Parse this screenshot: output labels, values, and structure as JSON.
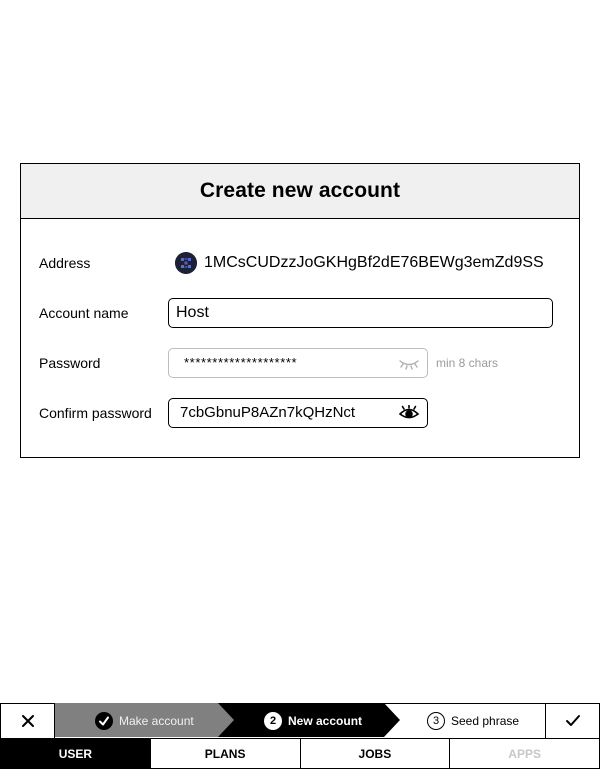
{
  "dialog": {
    "title": "Create new account",
    "address": {
      "label": "Address",
      "value": "1MCsCUDzzJoGKHgBf2dE76BEWg3emZd9SS",
      "icon": "identicon-icon"
    },
    "account_name": {
      "label": "Account name",
      "value": "Host"
    },
    "password": {
      "label": "Password",
      "value": "********************",
      "hint": "min 8 chars",
      "icon": "eye-hidden-icon"
    },
    "confirm_password": {
      "label": "Confirm password",
      "value": "7cbGbnuP8AZn7kQHzNct",
      "icon": "eye-visible-icon"
    }
  },
  "wizard": {
    "close_icon": "close-icon",
    "confirm_icon": "check-icon",
    "steps": [
      {
        "badge": "✓",
        "label": "Make account",
        "state": "done"
      },
      {
        "badge": "2",
        "label": "New account",
        "state": "current"
      },
      {
        "badge": "3",
        "label": "Seed phrase",
        "state": "upcoming"
      }
    ]
  },
  "tabs": [
    {
      "label": "USER",
      "state": "active"
    },
    {
      "label": "PLANS",
      "state": "normal"
    },
    {
      "label": "JOBS",
      "state": "normal"
    },
    {
      "label": "APPS",
      "state": "disabled"
    }
  ],
  "colors": {
    "step_done": "#808080",
    "step_current": "#000000",
    "header_bg": "#f0f0f0",
    "hint": "#9a9a9a",
    "tab_disabled": "#c8c8c8"
  }
}
